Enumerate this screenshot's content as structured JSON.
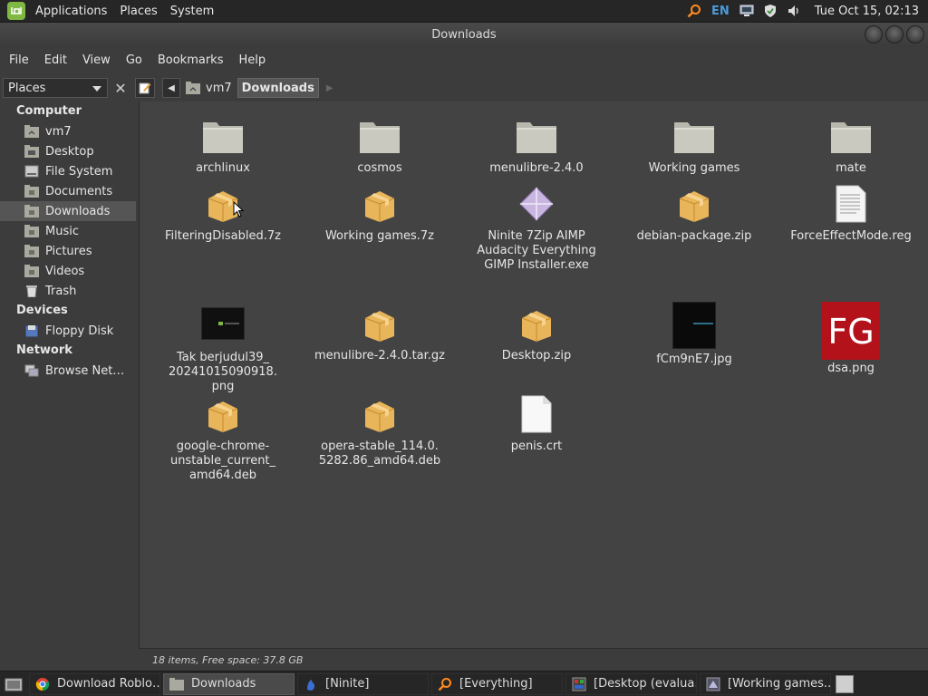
{
  "panel": {
    "menus": [
      "Applications",
      "Places",
      "System"
    ],
    "lang": "EN",
    "clock": "Tue Oct 15, 02:13"
  },
  "window": {
    "title": "Downloads"
  },
  "menubar": {
    "items": [
      "File",
      "Edit",
      "View",
      "Go",
      "Bookmarks",
      "Help"
    ]
  },
  "toolbar": {
    "pane_select": "Places",
    "breadcrumb": [
      "vm7",
      "Downloads"
    ]
  },
  "sidebar": {
    "computer_header": "Computer",
    "computer_items": [
      "vm7",
      "Desktop",
      "File System",
      "Documents",
      "Downloads",
      "Music",
      "Pictures",
      "Videos",
      "Trash"
    ],
    "devices_header": "Devices",
    "devices_items": [
      "Floppy Disk"
    ],
    "network_header": "Network",
    "network_items": [
      "Browse Net…"
    ]
  },
  "files": [
    {
      "label": "archlinux",
      "icon": "folder"
    },
    {
      "label": "cosmos",
      "icon": "folder"
    },
    {
      "label": "menulibre-2.4.0",
      "icon": "folder"
    },
    {
      "label": "Working games",
      "icon": "folder"
    },
    {
      "label": "mate",
      "icon": "folder"
    },
    {
      "label": "FilteringDisabled.7z",
      "icon": "archive"
    },
    {
      "label": "Working games.7z",
      "icon": "archive"
    },
    {
      "label": "Ninite 7Zip AIMP\nAudacity Everything\nGIMP Installer.exe",
      "icon": "exe"
    },
    {
      "label": "debian-package.zip",
      "icon": "archive"
    },
    {
      "label": "ForceEffectMode.reg",
      "icon": "text"
    },
    {
      "label": "Tak berjudul39_\n20241015090918.\npng",
      "icon": "image-dark"
    },
    {
      "label": "menulibre-2.4.0.tar.gz",
      "icon": "archive"
    },
    {
      "label": "Desktop.zip",
      "icon": "archive"
    },
    {
      "label": "fCm9nE7.jpg",
      "icon": "image-dark2"
    },
    {
      "label": "dsa.png",
      "icon": "image-fg"
    },
    {
      "label": "google-chrome-\nunstable_current_\namd64.deb",
      "icon": "archive"
    },
    {
      "label": "opera-stable_114.0.\n5282.86_amd64.deb",
      "icon": "archive"
    },
    {
      "label": "penis.crt",
      "icon": "blank"
    }
  ],
  "thumb_fg_text": "FG",
  "status": "18 items, Free space: 37.8 GB",
  "taskbar": {
    "tasks": [
      "Download Roblo…",
      "Downloads",
      "[Ninite]",
      "[Everything]",
      "[Desktop (evalua…",
      "[Working games.…"
    ]
  },
  "colors": {
    "folder": "#c9c9bf",
    "archive": "#e8b55a",
    "accent_mint": "#7fb842",
    "fg_red": "#b3121b"
  }
}
